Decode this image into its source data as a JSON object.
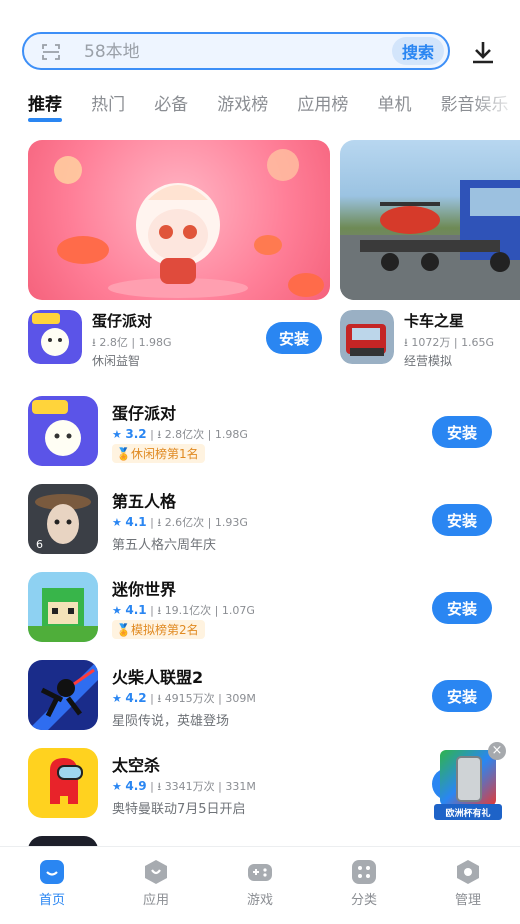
{
  "search": {
    "placeholder": "58本地",
    "button_label": "搜索"
  },
  "tabs": [
    "推荐",
    "热门",
    "必备",
    "游戏榜",
    "应用榜",
    "单机",
    "影音娱乐"
  ],
  "banners": [
    {
      "name": "蛋仔派对",
      "downloads": "2.8亿",
      "size": "1.98G",
      "tagline": "休闲益智",
      "install_label": "安装"
    },
    {
      "name": "卡车之星",
      "downloads": "1072万",
      "size": "1.65G",
      "tagline": "经营模拟"
    }
  ],
  "apps": [
    {
      "name": "蛋仔派对",
      "rating": "3.2",
      "downloads": "2.8亿次",
      "size": "1.98G",
      "badge": "休闲榜第1名",
      "sub": "",
      "install_label": "安装"
    },
    {
      "name": "第五人格",
      "rating": "4.1",
      "downloads": "2.6亿次",
      "size": "1.93G",
      "badge": "",
      "sub": "第五人格六周年庆",
      "install_label": "安装"
    },
    {
      "name": "迷你世界",
      "rating": "4.1",
      "downloads": "19.1亿次",
      "size": "1.07G",
      "badge": "模拟榜第2名",
      "sub": "",
      "install_label": "安装"
    },
    {
      "name": "火柴人联盟2",
      "rating": "4.2",
      "downloads": "4915万次",
      "size": "309M",
      "badge": "",
      "sub": "星陨传说，英雄登场",
      "install_label": "安装"
    },
    {
      "name": "太空杀",
      "rating": "4.9",
      "downloads": "3341万次",
      "size": "331M",
      "badge": "",
      "sub": "奥特曼联动7月5日开启",
      "install_label": "安装"
    }
  ],
  "promo": {
    "label": "欧洲杯有礼"
  },
  "bottom_nav": [
    {
      "label": "首页",
      "icon": "home-icon",
      "active": true
    },
    {
      "label": "应用",
      "icon": "apps-icon",
      "active": false
    },
    {
      "label": "游戏",
      "icon": "gamepad-icon",
      "active": false
    },
    {
      "label": "分类",
      "icon": "category-icon",
      "active": false
    },
    {
      "label": "管理",
      "icon": "manage-icon",
      "active": false
    }
  ],
  "colors": {
    "accent": "#2a86f2",
    "badge": "#e08a22"
  }
}
